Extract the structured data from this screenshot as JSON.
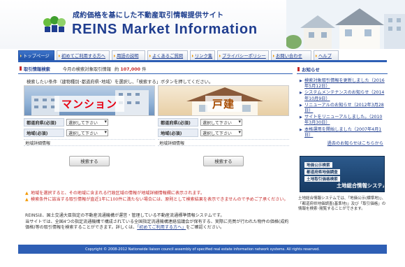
{
  "header": {
    "tagline": "成約価格を基にした不動産取引情報提供サイト",
    "brand": "REINS Market Information"
  },
  "nav": {
    "tabs": [
      {
        "label": "トップページ",
        "active": true
      },
      {
        "label": "初めてご利用する方へ",
        "active": false
      },
      {
        "label": "用語の説明",
        "active": false
      },
      {
        "label": "よくあるご質問",
        "active": false
      },
      {
        "label": "リンク集",
        "active": false
      },
      {
        "label": "プライバシーポリシー",
        "active": false
      },
      {
        "label": "お問い合わせ",
        "active": false
      },
      {
        "label": "ヘルプ",
        "active": false
      }
    ]
  },
  "main": {
    "section_title": "取引情報検索",
    "count_label": "今月の検索対象取引情報",
    "count_prefix": "約",
    "count_value": "107,000",
    "count_unit": "件",
    "instruction": "検索したい条件（建物種別･都道府県･地域）を選択し、「検索する」ボタンを押してください。",
    "mansion": {
      "photo_label": "マンション",
      "pref_label": "都道府県(必須)",
      "pref_value": "選択して下さい",
      "area_label": "地域(必須)",
      "area_value": "選択して下さい",
      "detail_label": "地域詳細情報",
      "button": "検索する"
    },
    "house": {
      "photo_label": "戸建",
      "pref_label": "都道府県(必須)",
      "pref_value": "選択して下さい",
      "area_label": "地域(必須)",
      "area_value": "選択して下さい",
      "detail_label": "地域詳細情報",
      "button": "検索する"
    },
    "notes": [
      "地域を選択すると、その地域に含まれる行政区域の情報が地域詳細情報欄に表示されます。",
      "検索条件に該当する取引情報が直近1年に100件に満たない場合には、原則として検索結果を表示できませんので予めご了承ください。"
    ],
    "about": {
      "line1": "REINSは、国土交通大臣指定の不動産流通機構が運営・管理している不動産流通標準情報システムです。",
      "line2": "当サイトでは、全国4つの指定流通機構で構成されている全国指定流通機構連絡協議会が保有する、実際に売買が行われた物件の価格(成約価格)等の取引情報を検索することができます。詳しくは、",
      "link": "「初めてご利用する方へ」",
      "line3": "をご確認ください。"
    }
  },
  "sidebar": {
    "title": "お知らせ",
    "news": [
      "検索対象取引情報を更新しました（2016年5月12日）",
      "システムメンテナンスのお知らせ（2014年10月9日）",
      "リニューアルのお知らせ（2012年3月28日）",
      "サイトをリニューアルしました。（2010年3月30日）",
      "本格運用を開始しました（2007年4月1日）"
    ],
    "more_link": "過去のお知らせはこちらから",
    "banner": {
      "lines": [
        "地価公示検索",
        "都道府県地価調査",
        "土地取引価格検索"
      ],
      "title": "土地総合情報システム"
    },
    "description": "土地総合情報システムでは、「地価公示(標準地)」、「都道府県地価調査(基準地)」及び「取引価格」の情報を検索･閲覧することができます。"
  },
  "footer": {
    "copyright": "Copyright © 2008-2012 Nationwide liaison council assembly of specified real estate information network systems. All rights reserved."
  },
  "colors": {
    "brand_blue": "#1f3d8f",
    "nav_blue": "#2e5fb5",
    "accent_red": "#c62828",
    "warn_orange": "#f39800"
  }
}
